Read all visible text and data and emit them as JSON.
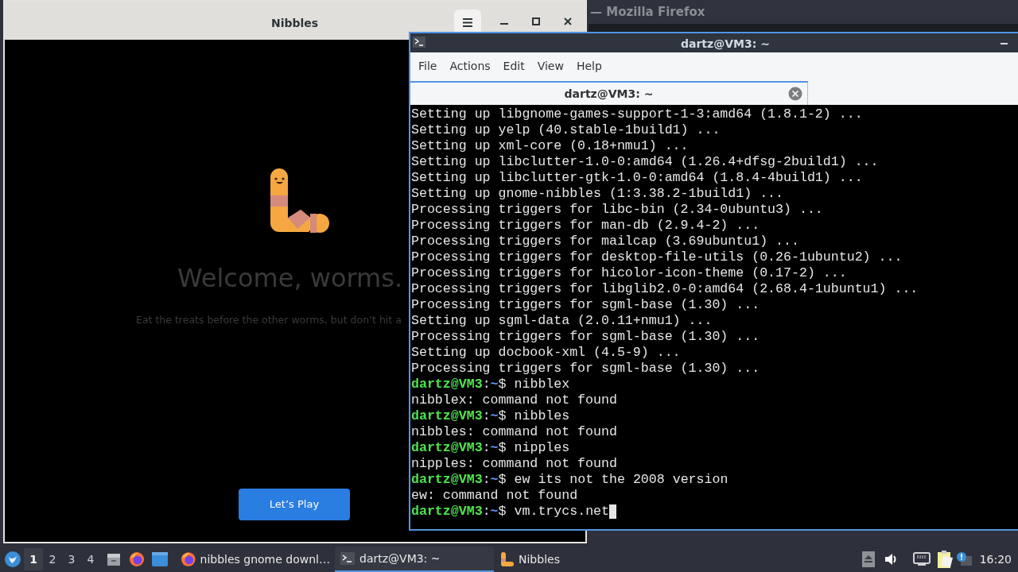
{
  "background_window": {
    "title": "— Mozilla Firefox"
  },
  "nibbles_window": {
    "title": "Nibbles",
    "heading": "Welcome, worms.",
    "subtitle": "Eat the treats before the other worms, but don’t hit a",
    "play_button": "Let’s Play"
  },
  "terminal_window": {
    "title": "dartz@VM3: ~",
    "menu": [
      "File",
      "Actions",
      "Edit",
      "View",
      "Help"
    ],
    "tabs": [
      {
        "label": "dartz@VM3: ~",
        "selected": true
      }
    ],
    "lines": [
      {
        "kind": "output",
        "text": "Setting up libgnome-games-support-1-3:amd64 (1.8.1-2) ..."
      },
      {
        "kind": "output",
        "text": "Setting up yelp (40.stable-1build1) ..."
      },
      {
        "kind": "output",
        "text": "Setting up xml-core (0.18+nmu1) ..."
      },
      {
        "kind": "output",
        "text": "Setting up libclutter-1.0-0:amd64 (1.26.4+dfsg-2build1) ..."
      },
      {
        "kind": "output",
        "text": "Setting up libclutter-gtk-1.0-0:amd64 (1.8.4-4build1) ..."
      },
      {
        "kind": "output",
        "text": "Setting up gnome-nibbles (1:3.38.2-1build1) ..."
      },
      {
        "kind": "output",
        "text": "Processing triggers for libc-bin (2.34-0ubuntu3) ..."
      },
      {
        "kind": "output",
        "text": "Processing triggers for man-db (2.9.4-2) ..."
      },
      {
        "kind": "output",
        "text": "Processing triggers for mailcap (3.69ubuntu1) ..."
      },
      {
        "kind": "output",
        "text": "Processing triggers for desktop-file-utils (0.26-1ubuntu2) ..."
      },
      {
        "kind": "output",
        "text": "Processing triggers for hicolor-icon-theme (0.17-2) ..."
      },
      {
        "kind": "output",
        "text": "Processing triggers for libglib2.0-0:amd64 (2.68.4-1ubuntu1) ..."
      },
      {
        "kind": "output",
        "text": "Processing triggers for sgml-base (1.30) ..."
      },
      {
        "kind": "output",
        "text": "Setting up sgml-data (2.0.11+nmu1) ..."
      },
      {
        "kind": "output",
        "text": "Processing triggers for sgml-base (1.30) ..."
      },
      {
        "kind": "output",
        "text": "Setting up docbook-xml (4.5-9) ..."
      },
      {
        "kind": "output",
        "text": "Processing triggers for sgml-base (1.30) ..."
      },
      {
        "kind": "prompt",
        "user": "dartz@VM3",
        "separator": ":",
        "path": "~",
        "sign": "$",
        "command": "nibblex"
      },
      {
        "kind": "output",
        "text": "nibblex: command not found"
      },
      {
        "kind": "prompt",
        "user": "dartz@VM3",
        "separator": ":",
        "path": "~",
        "sign": "$",
        "command": "nibbles"
      },
      {
        "kind": "output",
        "text": "nibbles: command not found"
      },
      {
        "kind": "prompt",
        "user": "dartz@VM3",
        "separator": ":",
        "path": "~",
        "sign": "$",
        "command": "nipples"
      },
      {
        "kind": "output",
        "text": "nipples: command not found"
      },
      {
        "kind": "prompt",
        "user": "dartz@VM3",
        "separator": ":",
        "path": "~",
        "sign": "$",
        "command": "ew its not the 2008 version"
      },
      {
        "kind": "output",
        "text": "ew: command not found"
      },
      {
        "kind": "prompt",
        "user": "dartz@VM3",
        "separator": ":",
        "path": "~",
        "sign": "$",
        "command": "vm.trycs.net",
        "cursor": true
      }
    ]
  },
  "taskbar": {
    "workspaces": [
      {
        "label": "1",
        "selected": true
      },
      {
        "label": "2",
        "selected": false
      },
      {
        "label": "3",
        "selected": false
      },
      {
        "label": "4",
        "selected": false
      }
    ],
    "tasks": [
      {
        "kind": "browser",
        "label": "nibbles gnome downl…",
        "selected": false
      },
      {
        "kind": "terminal",
        "label": "dartz@VM3: ~",
        "selected": true
      },
      {
        "kind": "worm",
        "label": "Nibbles",
        "selected": false
      }
    ],
    "clock": "16:20"
  }
}
